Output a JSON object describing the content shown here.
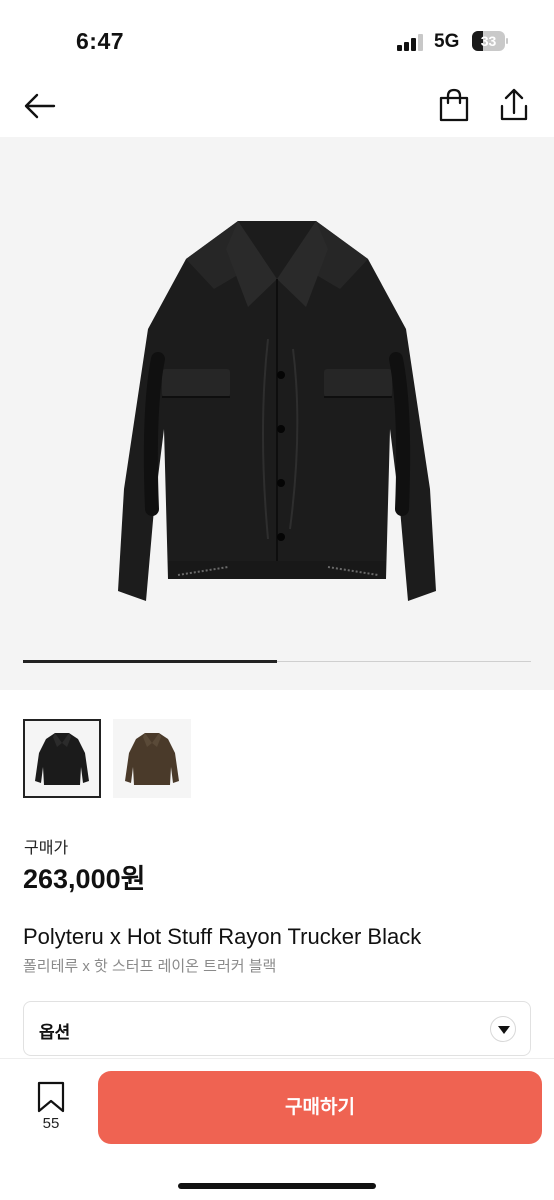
{
  "status_bar": {
    "time": "6:47",
    "network": "5G",
    "battery": "33",
    "battery_level": 0.33
  },
  "nav": {
    "back_icon": "arrow-left-icon",
    "bag_icon": "shopping-bag-icon",
    "share_icon": "share-icon"
  },
  "gallery": {
    "main_image": "black-jacket-image",
    "carousel_progress": 0.5,
    "thumbnails": [
      {
        "name": "black-jacket-thumbnail",
        "color": "#1b1b1b",
        "selected": true
      },
      {
        "name": "brown-jacket-thumbnail",
        "color": "#4a3a2a",
        "selected": false
      }
    ]
  },
  "price": {
    "label": "구매가",
    "value": "263,000원"
  },
  "product": {
    "name": "Polyteru x Hot Stuff Rayon Trucker Black",
    "subname": "폴리테루 x 핫 스터프 레이온 트러커 블랙"
  },
  "option": {
    "label": "옵션",
    "icon": "chevron-down-icon"
  },
  "bottom_bar": {
    "bookmark_icon": "bookmark-icon",
    "bookmark_count": "55",
    "buy_label": "구매하기"
  },
  "colors": {
    "accent": "#ef6352",
    "hero_bg": "#f4f4f4",
    "text_primary": "#111111",
    "text_secondary": "#8a8a8a"
  }
}
